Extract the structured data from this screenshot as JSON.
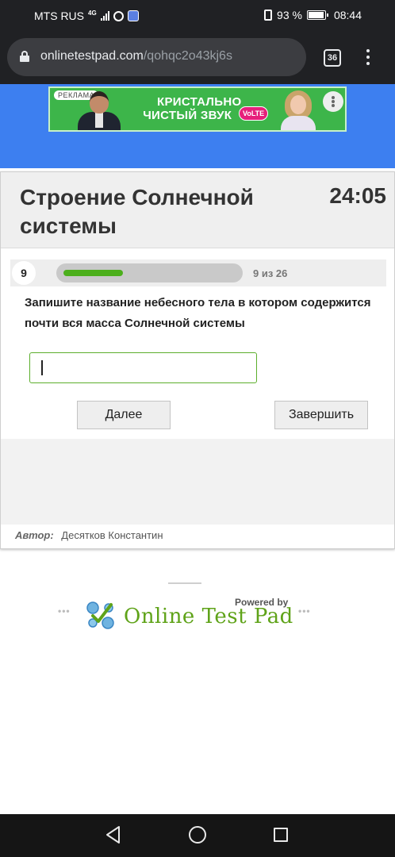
{
  "status_bar": {
    "carrier": "MTS RUS",
    "network": "4G",
    "battery_percent": "93 %",
    "time": "08:44",
    "battery_level": 0.93
  },
  "browser": {
    "url_domain": "onlinetestpad.com",
    "url_path": "/qohqc2o43kj6s",
    "tab_count": "36"
  },
  "ad": {
    "tag": "РЕКЛАМА",
    "line1": "КРИСТАЛЬНО",
    "line2": "ЧИСТЫЙ ЗВУК",
    "badge": "VoLTE",
    "colors": {
      "background": "#3db54a",
      "badge": "#e6207b"
    }
  },
  "test": {
    "title": "Строение Солнечной системы",
    "timer": "24:05",
    "question_number": "9",
    "progress_text": "9 из 26",
    "progress_fraction": 0.346,
    "question_text": "Запишите название небесного тела в котором содержится почти вся масса Солнечной системы",
    "answer_value": "",
    "answer_placeholder": "",
    "next_label": "Далее",
    "finish_label": "Завершить",
    "author_label": "Автор:",
    "author_name": "Десятков Константин",
    "colors": {
      "accent": "#4caf1c",
      "page_band": "#3d7ff0"
    }
  },
  "footer": {
    "powered_by": "Powered by",
    "brand": "Online Test Pad",
    "dots": "•••",
    "brand_color": "#5fa319"
  },
  "nav": {
    "icons": [
      "back-icon",
      "home-icon",
      "recent-apps-icon"
    ]
  }
}
